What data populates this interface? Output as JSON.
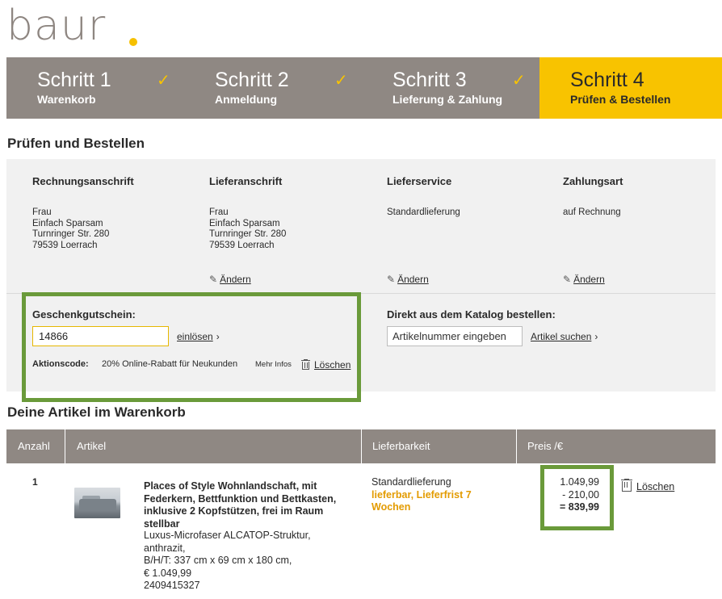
{
  "brand": {
    "logo_text": "baur",
    "accent_color": "#f8c300"
  },
  "steps": [
    {
      "title": "Schritt 1",
      "subtitle": "Warenkorb",
      "done": true
    },
    {
      "title": "Schritt 2",
      "subtitle": "Anmeldung",
      "done": true
    },
    {
      "title": "Schritt 3",
      "subtitle": "Lieferung & Zahlung",
      "done": true
    },
    {
      "title": "Schritt 4",
      "subtitle": "Prüfen & Bestellen",
      "done": false
    }
  ],
  "check_glyph": "✓",
  "review": {
    "heading": "Prüfen und Bestellen",
    "billing": {
      "heading": "Rechnungsanschrift",
      "lines": [
        "Frau",
        "Einfach Sparsam",
        "Turnringer Str. 280",
        "79539 Loerrach"
      ]
    },
    "shipping": {
      "heading": "Lieferanschrift",
      "lines": [
        "Frau",
        "Einfach Sparsam",
        "Turnringer Str. 280",
        "79539 Loerrach"
      ],
      "edit": "Ändern"
    },
    "service": {
      "heading": "Lieferservice",
      "value": "Standardlieferung",
      "edit": "Ändern"
    },
    "payment": {
      "heading": "Zahlungsart",
      "value": "auf Rechnung",
      "edit": "Ändern"
    }
  },
  "gift": {
    "heading": "Geschenkgutschein:",
    "input_value": "14866",
    "redeem_label": "einlösen",
    "promo_label": "Aktionscode:",
    "promo_text": "20% Online-Rabatt für Neukunden",
    "more_info": "Mehr Infos",
    "delete_label": "Löschen"
  },
  "catalog": {
    "heading": "Direkt aus dem Katalog bestellen:",
    "placeholder": "Artikelnummer eingeben",
    "search_label": "Artikel suchen"
  },
  "cart": {
    "heading": "Deine Artikel im Warenkorb",
    "columns": [
      "Anzahl",
      "Artikel",
      "Lieferbarkeit",
      "Preis /€"
    ],
    "items": [
      {
        "qty": "1",
        "title": "Places of Style Wohnlandschaft, mit Federkern, Bettfunktion und Bettkasten, inklusive 2 Kopfstützen, frei im Raum stellbar",
        "details": [
          "Luxus-Microfaser ALCATOP-Struktur,",
          "anthrazit,",
          "B/H/T: 337 cm x 69 cm x 180 cm,",
          "€ 1.049,99",
          "2409415327"
        ],
        "delivery": "Standardlieferung",
        "availability": "lieferbar, Lieferfrist 7 Wochen",
        "price": "1.049,99",
        "discount": "- 210,00",
        "total": "= 839,99",
        "delete_label": "Löschen"
      }
    ]
  }
}
